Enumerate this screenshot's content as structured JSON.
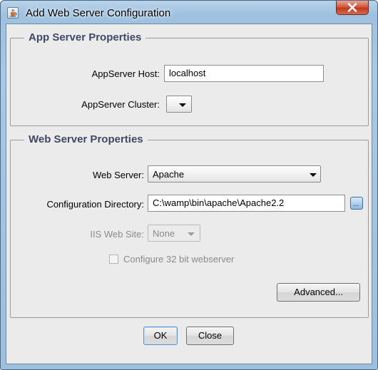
{
  "window": {
    "title": "Add Web Server Configuration",
    "icon": "java-cup-icon",
    "close_icon": "close-icon"
  },
  "app_server": {
    "group_title": "App Server Properties",
    "host_label": "AppServer Host:",
    "host_value": "localhost",
    "cluster_label": "AppServer Cluster:",
    "cluster_value": ""
  },
  "web_server": {
    "group_title": "Web Server Properties",
    "server_label": "Web Server:",
    "server_value": "Apache",
    "config_dir_label": "Configuration Directory:",
    "config_dir_value": "C:\\wamp\\bin\\apache\\Apache2.2",
    "browse_icon": "browse-icon",
    "iis_site_label": "IIS Web Site:",
    "iis_site_value": "None",
    "configure32_label": "Configure 32 bit webserver",
    "configure32_checked": false,
    "advanced_label": "Advanced..."
  },
  "footer": {
    "ok_label": "OK",
    "close_label": "Close"
  }
}
